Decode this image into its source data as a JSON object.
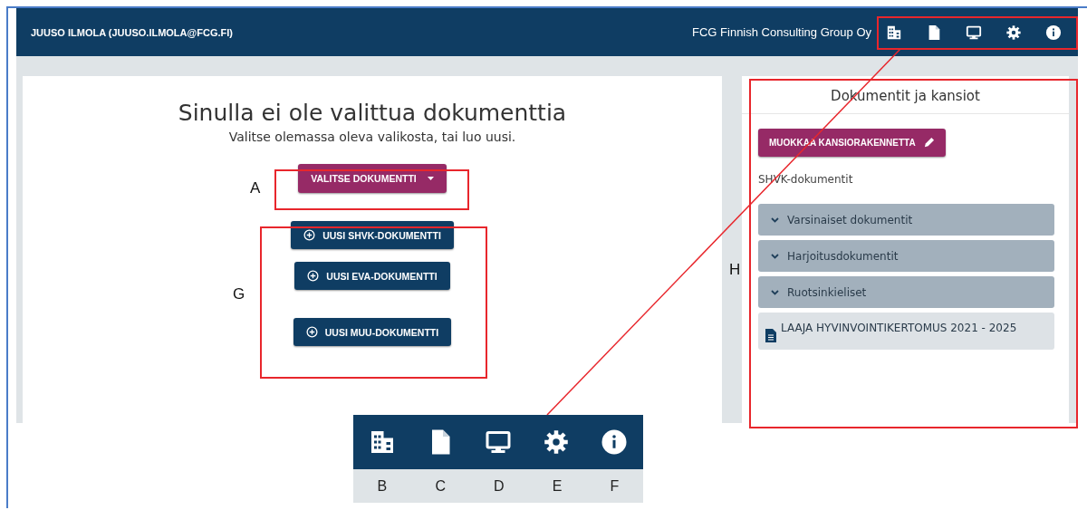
{
  "header": {
    "user": "JUUSO ILMOLA (JUUSO.ILMOLA@FCG.FI)",
    "organization": "FCG Finnish Consulting Group Oy",
    "icons": [
      {
        "kind": "building"
      },
      {
        "kind": "file"
      },
      {
        "kind": "monitor"
      },
      {
        "kind": "gear"
      },
      {
        "kind": "info"
      }
    ]
  },
  "main": {
    "title": "Sinulla ei ole valittua dokumenttia",
    "subtitle": "Valitse olemassa oleva valikosta, tai luo uusi.",
    "select_button": "VALITSE DOKUMENTTI",
    "new_buttons": [
      "UUSI SHVK-DOKUMENTTI",
      "UUSI EVA-DOKUMENTTI",
      "UUSI MUU-DOKUMENTTI"
    ]
  },
  "sidebar": {
    "title": "Dokumentit ja kansiot",
    "edit_button": "MUOKKAA KANSIORAKENNETTA",
    "section_label": "SHVK-dokumentit",
    "folders": [
      "Varsinaiset dokumentit",
      "Harjoitusdokumentit",
      "Ruotsinkieliset"
    ],
    "documents": [
      "LAAJA HYVINVOINTIKERTOMUS 2021 - 2025"
    ]
  },
  "annotations": {
    "labels": [
      "A",
      "G",
      "H"
    ],
    "callout": {
      "icons": [
        {
          "kind": "building",
          "letter": "B"
        },
        {
          "kind": "file",
          "letter": "C"
        },
        {
          "kind": "monitor",
          "letter": "D"
        },
        {
          "kind": "gear",
          "letter": "E"
        },
        {
          "kind": "info",
          "letter": "F"
        }
      ]
    }
  }
}
